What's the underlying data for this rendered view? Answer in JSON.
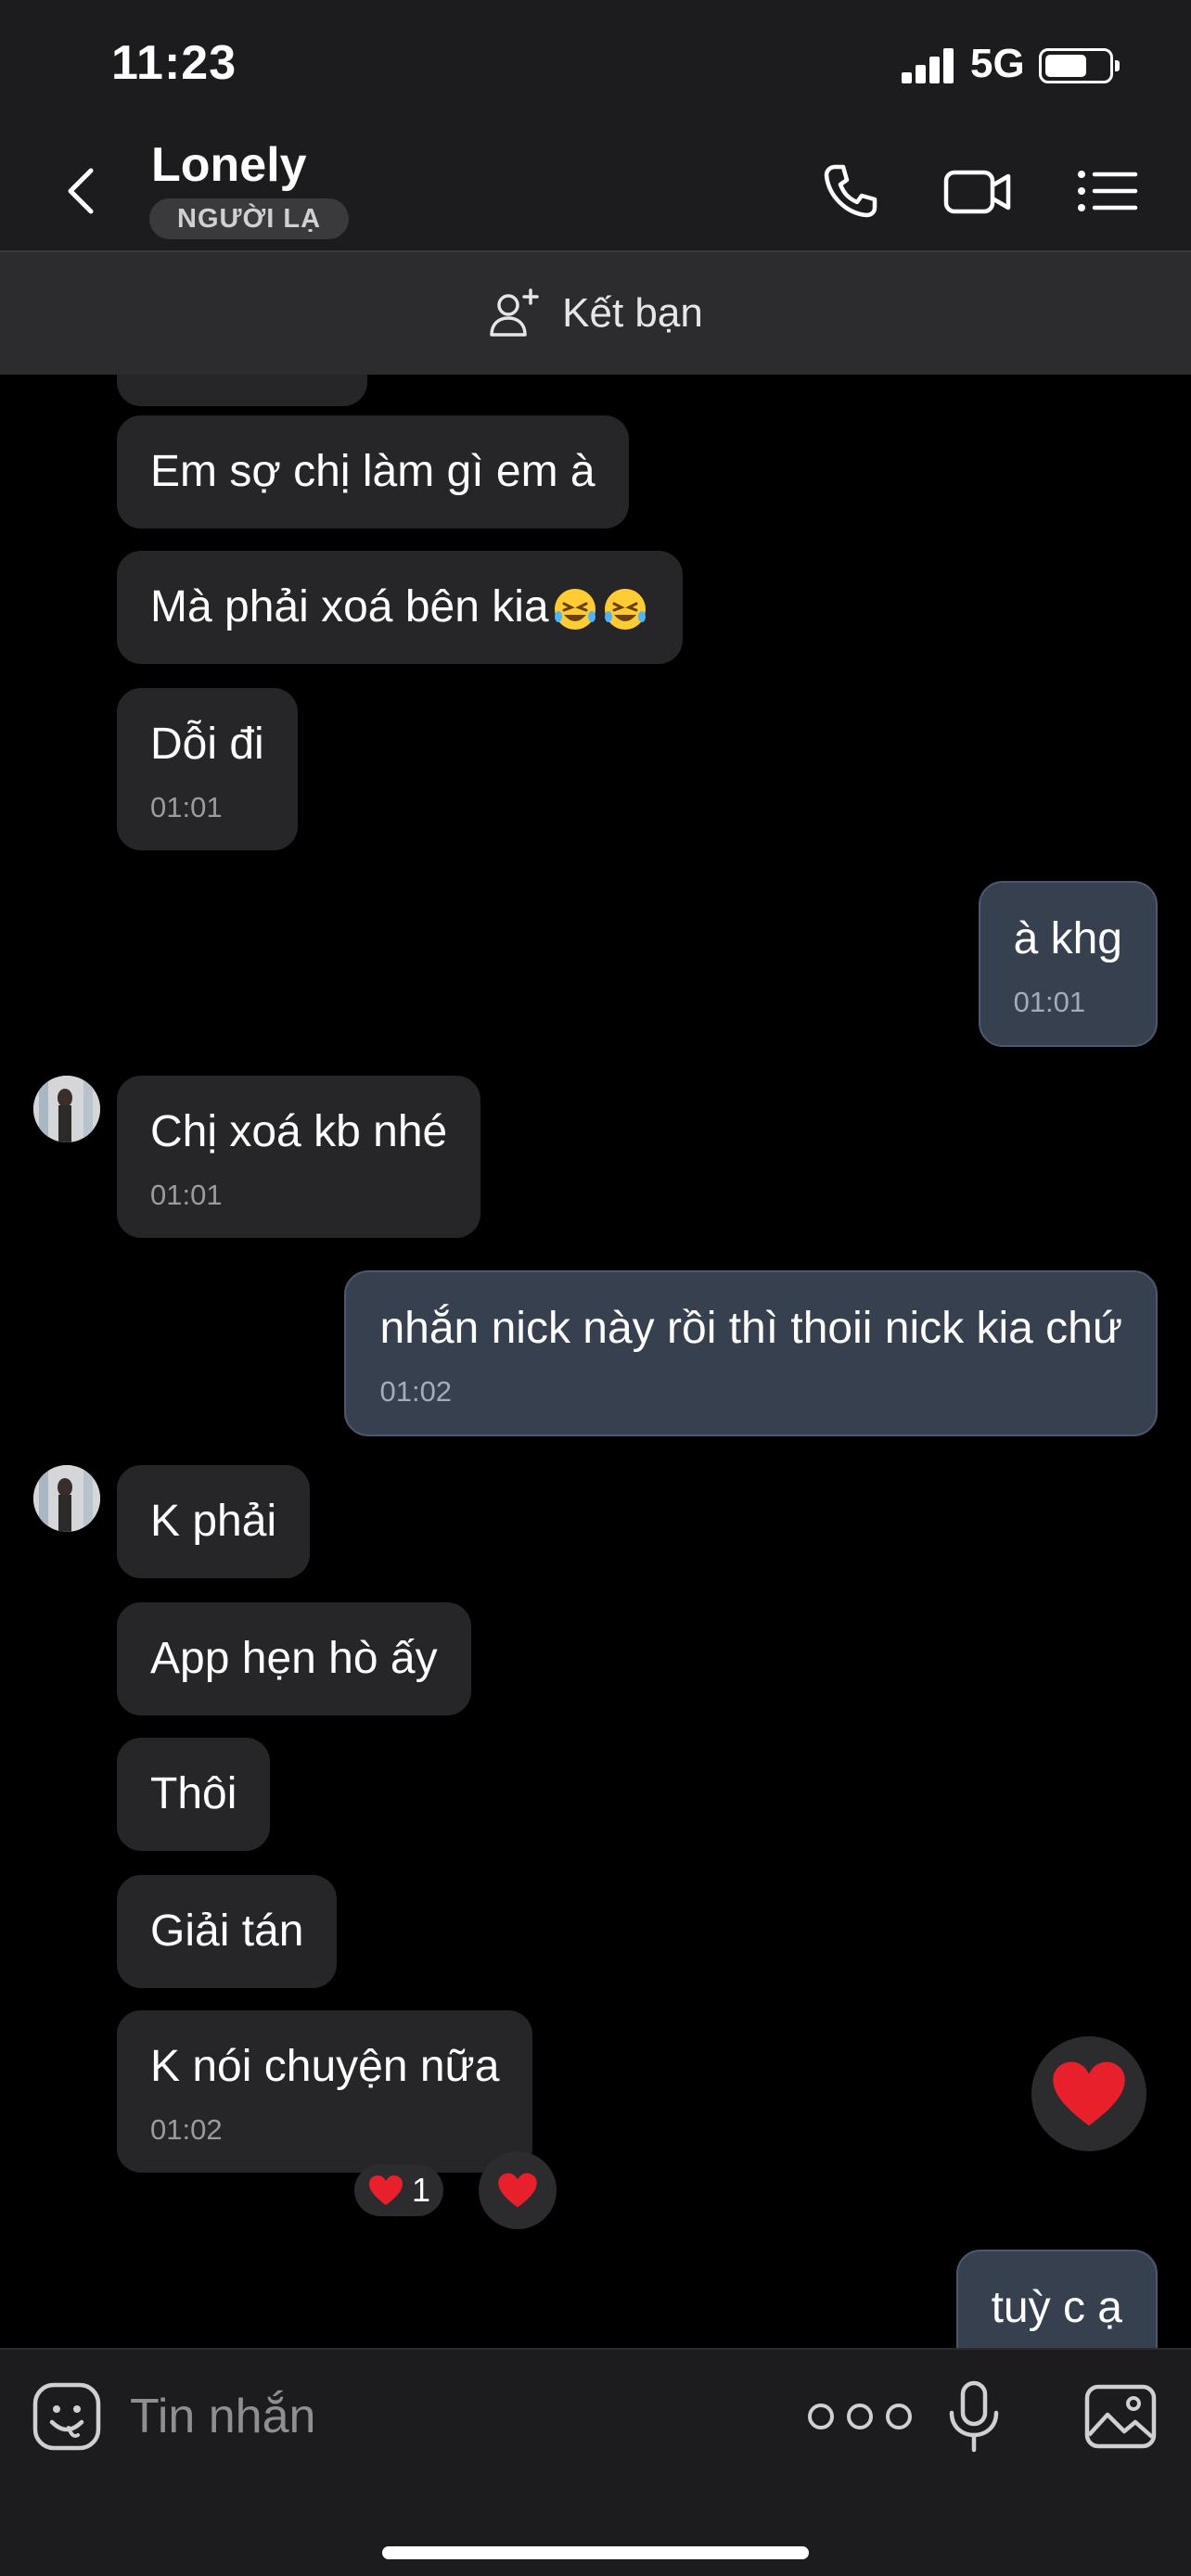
{
  "status_bar": {
    "time": "11:23",
    "network": "5G",
    "battery_level": 0.6
  },
  "header": {
    "contact_name": "Lonely",
    "badge": "NGƯỜI LẠ",
    "icons": [
      "back-icon",
      "phone-icon",
      "video-icon",
      "menu-icon"
    ]
  },
  "add_friend": {
    "label": "Kết bạn",
    "icon": "add-user-icon"
  },
  "messages": [
    {
      "dir": "in",
      "text": "Em sợ chị làm gì em à"
    },
    {
      "dir": "in",
      "text": "Mà phải xoá bên kia",
      "emoji": [
        "rofl-emoji",
        "rofl-emoji"
      ]
    },
    {
      "dir": "in",
      "text": "Dỗi đi",
      "time": "01:01"
    },
    {
      "dir": "out",
      "text": "à khg",
      "time": "01:01"
    },
    {
      "dir": "in",
      "text": "Chị xoá kb nhé",
      "time": "01:01"
    },
    {
      "dir": "out",
      "text": "nhắn nick này rồi thì thoii nick kia chứ",
      "time": "01:02"
    },
    {
      "dir": "in",
      "text": "K phải"
    },
    {
      "dir": "in",
      "text": "App hẹn hò ấy"
    },
    {
      "dir": "in",
      "text": "Thôi"
    },
    {
      "dir": "in",
      "text": "Giải tán"
    },
    {
      "dir": "in",
      "text": "K nói chuyện nữa",
      "time": "01:02",
      "reaction": {
        "emoji": "heart-icon",
        "count": "1"
      }
    },
    {
      "dir": "out",
      "text": "tuỳ c ạ"
    }
  ],
  "input": {
    "placeholder": "Tin nhắn"
  },
  "colors": {
    "background": "#000000",
    "bar": "#1c1c1e",
    "incoming_bubble": "#262628",
    "outgoing_bubble": "#36404f",
    "heart": "#e8202c"
  }
}
